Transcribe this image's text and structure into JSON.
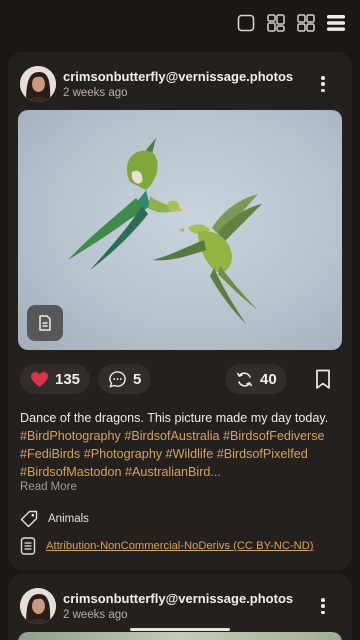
{
  "view_modes": {
    "icons": [
      "single-view-icon",
      "compact-grid-icon",
      "grid-icon",
      "list-view-icon"
    ]
  },
  "posts": [
    {
      "username": "crimsonbutterfly@vernissage.photos",
      "timestamp": "2 weeks ago",
      "likes": "135",
      "comments": "5",
      "boosts": "40",
      "caption_text": "Dance of the dragons. This picture made my day today. ",
      "hashtags": "#BirdPhotography #BirdsofAustralia #BirdsofFediverse #FediBirds #Photography #Wildlife #BirdsofPixelfed #BirdsofMastodon #AustralianBird...",
      "read_more": "Read More",
      "category": "Animals",
      "license": "Attribution-NonCommercial-NoDerivs (CC BY-NC-ND)"
    },
    {
      "username": "crimsonbutterfly@vernissage.photos",
      "timestamp": "2 weeks ago"
    }
  ],
  "colors": {
    "background": "#1b1715",
    "card": "#24201e",
    "accent": "#d9a25a",
    "like": "#e0314b"
  }
}
